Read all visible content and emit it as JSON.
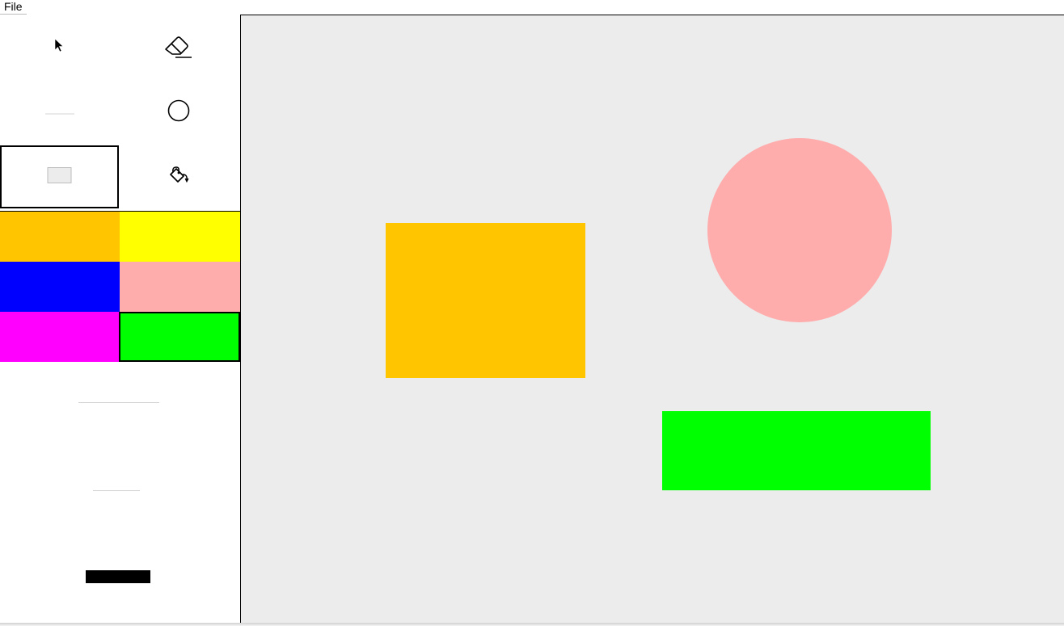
{
  "menu": {
    "file_label": "File"
  },
  "tools": [
    {
      "name": "select-tool",
      "icon": "cursor-arrow-icon",
      "selected": false
    },
    {
      "name": "eraser-tool",
      "icon": "eraser-icon",
      "selected": false
    },
    {
      "name": "line-tool",
      "icon": "line-icon",
      "selected": false
    },
    {
      "name": "ellipse-tool",
      "icon": "circle-icon",
      "selected": false
    },
    {
      "name": "rectangle-tool",
      "icon": "rectangle-icon",
      "selected": true
    },
    {
      "name": "fill-tool",
      "icon": "paint-bucket-icon",
      "selected": false
    }
  ],
  "palette": [
    {
      "name": "orange",
      "color": "#ffc600",
      "selected": false
    },
    {
      "name": "yellow",
      "color": "#ffff00",
      "selected": false
    },
    {
      "name": "blue",
      "color": "#0000ff",
      "selected": false
    },
    {
      "name": "pink",
      "color": "#ffacac",
      "selected": false
    },
    {
      "name": "magenta",
      "color": "#ff00ff",
      "selected": false
    },
    {
      "name": "green",
      "color": "#00ff00",
      "selected": true
    }
  ],
  "canvas": {
    "background": "#ececec",
    "shapes": [
      {
        "type": "rectangle",
        "color": "#ffc600"
      },
      {
        "type": "ellipse",
        "color": "#ffacac"
      },
      {
        "type": "rectangle",
        "color": "#00ff00"
      }
    ]
  }
}
